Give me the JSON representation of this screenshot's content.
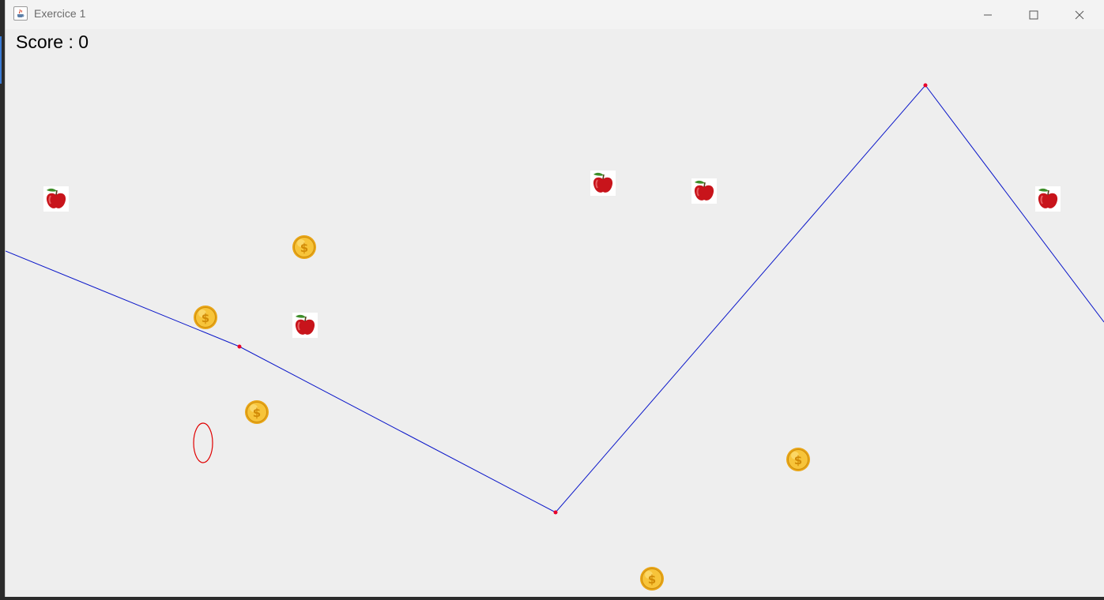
{
  "window": {
    "title": "Exercice 1",
    "controls": [
      "minimize",
      "maximize",
      "close"
    ]
  },
  "game": {
    "score_text": "Score : 0",
    "colors": {
      "background": "#eeeeee",
      "track": "#0000cc",
      "track_nodes": "#e8002a",
      "player_outline": "#e00000"
    },
    "icons": {
      "apple": "apple-icon",
      "coin": "dollar-coin-icon",
      "player": "red-ellipse"
    }
  }
}
